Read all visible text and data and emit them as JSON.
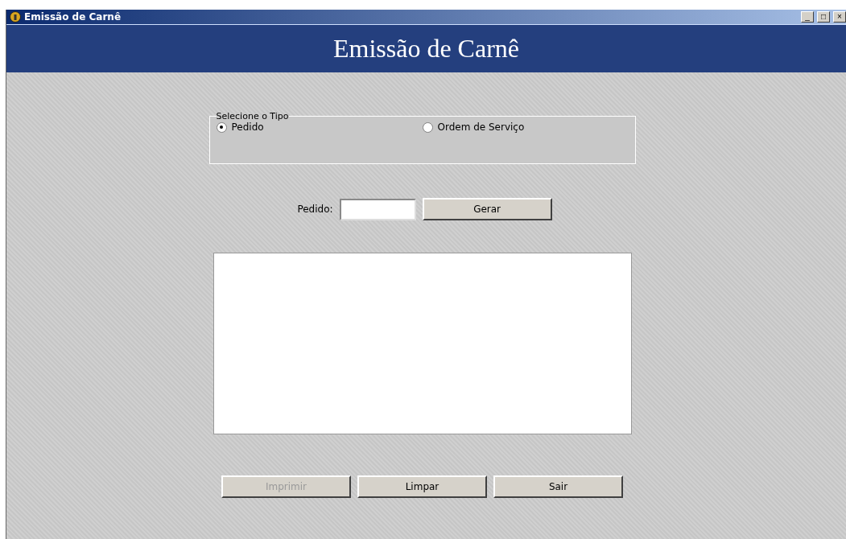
{
  "window": {
    "title": "Emissão de Carnê",
    "controls": [
      "_",
      "□",
      "×"
    ]
  },
  "header": {
    "title": "Emissão de Carnê"
  },
  "type_group": {
    "legend": "Selecione o Tipo",
    "options": [
      {
        "label": "Pedido",
        "selected": true
      },
      {
        "label": "Ordem de Serviço",
        "selected": false
      }
    ]
  },
  "order": {
    "label": "Pedido:",
    "button": {
      "label": "Gerar",
      "disabled": false
    }
  },
  "buttons": [
    {
      "label": "Imprimir",
      "disabled": true
    },
    {
      "label": "Limpar",
      "disabled": false
    },
    {
      "label": "Sair",
      "disabled": false
    }
  ]
}
